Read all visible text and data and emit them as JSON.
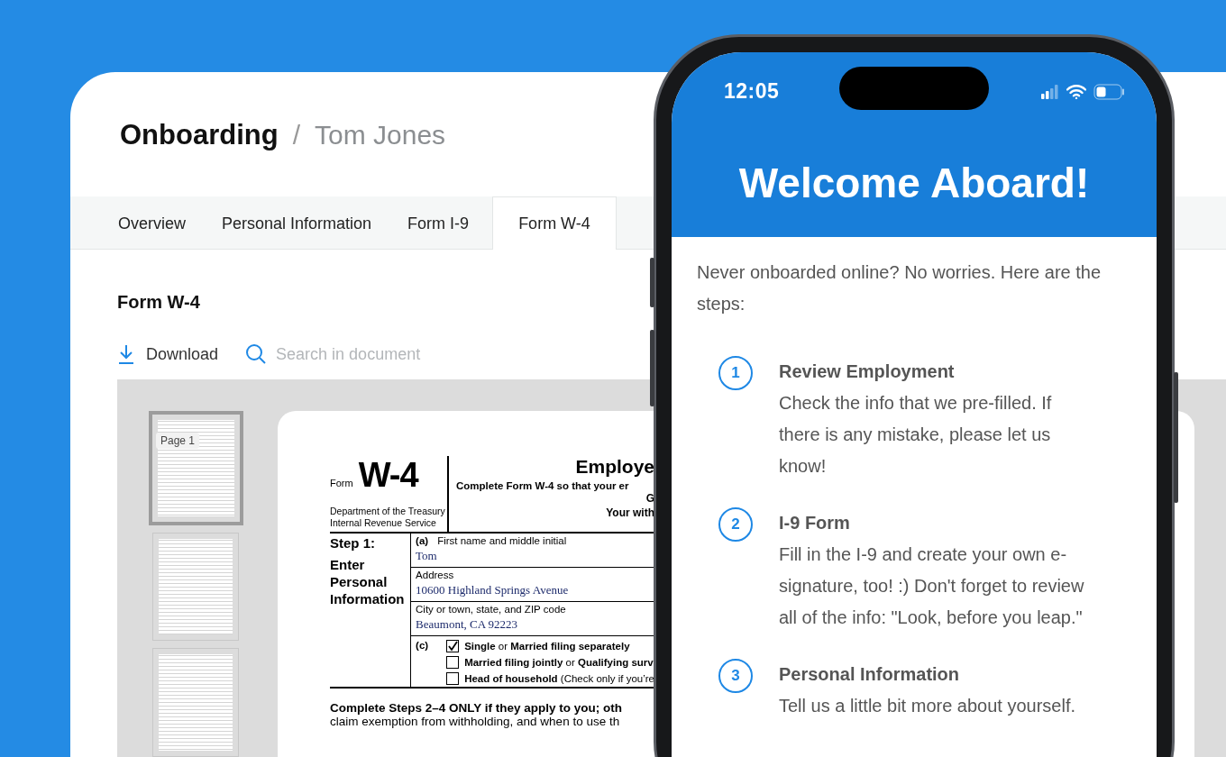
{
  "header": {
    "title": "Onboarding",
    "separator": "/",
    "subtitle": "Tom Jones"
  },
  "tabs": [
    {
      "label": "Overview",
      "selected": false
    },
    {
      "label": "Personal Information",
      "selected": false
    },
    {
      "label": "Form I-9",
      "selected": false
    },
    {
      "label": "Form W-4",
      "selected": true
    }
  ],
  "section_title": "Form W-4",
  "toolbar": {
    "download": "Download",
    "search_placeholder": "Search in document"
  },
  "thumbnails": [
    {
      "selected": true,
      "label": "Page 1"
    },
    {
      "selected": false
    },
    {
      "selected": false
    }
  ],
  "form": {
    "form_word": "Form",
    "form_number": "W-4",
    "agency": [
      "Department of the Treasury",
      "Internal Revenue Service"
    ],
    "title": "Employe",
    "instruction": "Complete Form W-4 so that your er",
    "line_3": "G",
    "line_4": "Your with",
    "step_label": "Step 1:",
    "step_title": "Enter Personal Information",
    "fields": [
      {
        "letter": "(a)",
        "label": "First name and middle initial",
        "value": "Tom"
      },
      {
        "label": "Address",
        "value": "10600 Highland Springs Avenue"
      },
      {
        "label": "City or town, state, and ZIP code",
        "value": "Beaumont, CA 92223"
      }
    ],
    "filing_letter": "(c)",
    "filing_options": [
      {
        "label": "**Single** or **Married filing separately**",
        "checked": true
      },
      {
        "label": "**Married filing jointly** or **Qualifying surv**",
        "checked": false
      },
      {
        "label": "**Head of household** (Check only if you’re",
        "checked": false
      }
    ],
    "note_bold": "Complete Steps 2–4 ONLY if they apply to you; oth",
    "note": "claim exemption from withholding, and when to use th"
  },
  "phone": {
    "time": "12:05",
    "heading": "Welcome Aboard!",
    "intro": "Never onboarded online? No worries. Here are the steps:",
    "steps": [
      {
        "number": "1",
        "title": "Review Employment",
        "text": "Check the info that we pre-filled. If there is any mistake, please let us know!"
      },
      {
        "number": "2",
        "title": "I-9 Form",
        "text": "Fill in the I-9 and create your own e-signature, too! :) Don't forget to review all of the info: \"Look, before you leap.\""
      },
      {
        "number": "3",
        "title": "Personal Information",
        "text": "Tell us a little bit more about yourself."
      }
    ]
  }
}
